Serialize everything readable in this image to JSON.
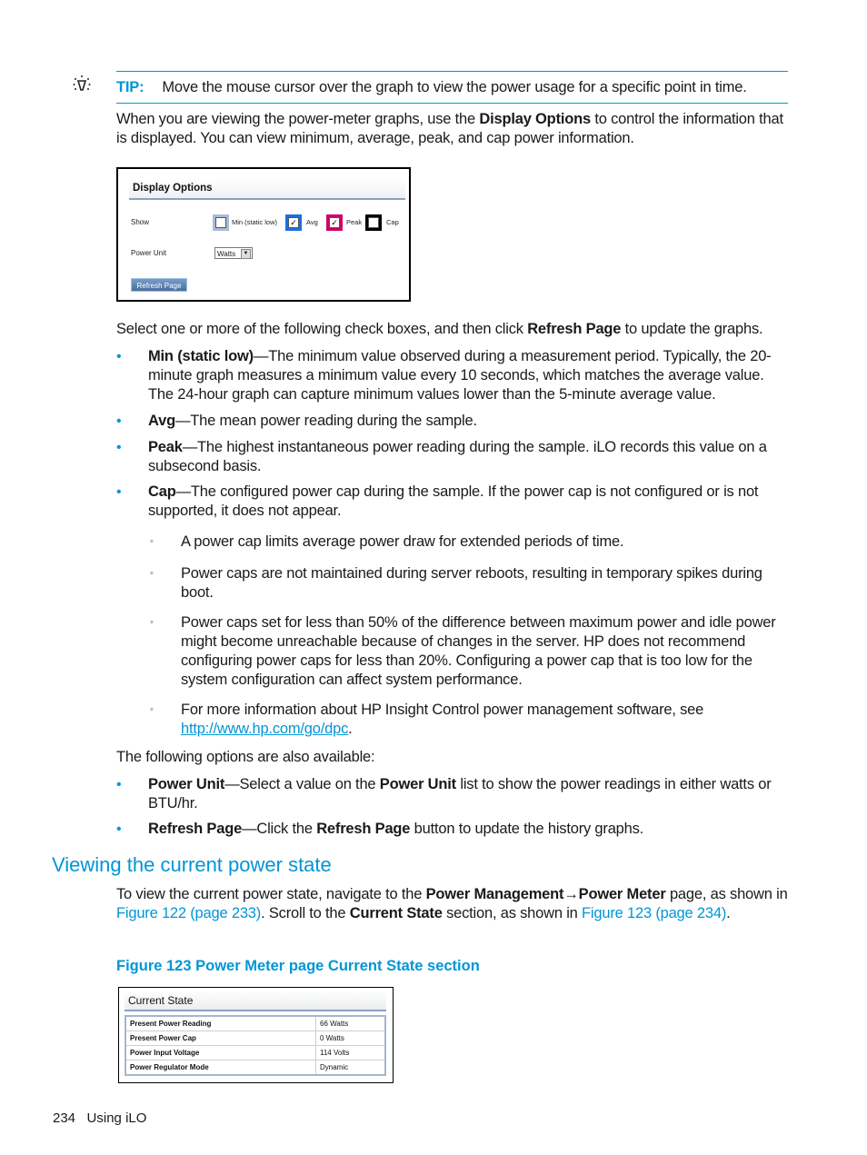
{
  "tip": {
    "icon": "lightbulb-icon",
    "label": "TIP:",
    "text": "Move the mouse cursor over the graph to view the power usage for a specific point in time."
  },
  "intro": {
    "p1_before": "When you are viewing the power-meter graphs, use the ",
    "p1_bold": "Display Options",
    "p1_after": " to control the information that is displayed. You can view minimum, average, peak, and cap power information."
  },
  "display_options": {
    "title": "Display Options",
    "show_label": "Show",
    "checkboxes": [
      {
        "label": "Min (static low)",
        "checked": false,
        "color": "#a9bcd6"
      },
      {
        "label": "Avg",
        "checked": true,
        "color": "#1a6fe0"
      },
      {
        "label": "Peak",
        "checked": true,
        "color": "#cc0066"
      },
      {
        "label": "Cap",
        "checked": false,
        "color": "#000000"
      }
    ],
    "checked_glyph": "✓",
    "power_unit_label": "Power Unit",
    "power_unit_value": "Watts",
    "dropdown_arrow": "▼",
    "refresh_button": "Refresh Page"
  },
  "select_para": {
    "before": "Select one or more of the following check boxes, and then click ",
    "bold": "Refresh Page",
    "after": " to update the graphs."
  },
  "bullets": [
    {
      "term": "Min (static low)",
      "text": "—The minimum value observed during a measurement period. Typically, the 20-minute graph measures a minimum value every 10 seconds, which matches the average value. The 24-hour graph can capture minimum values lower than the 5-minute average value."
    },
    {
      "term": "Avg",
      "text": "—The mean power reading during the sample."
    },
    {
      "term": "Peak",
      "text": "—The highest instantaneous power reading during the sample. iLO records this value on a subsecond basis."
    },
    {
      "term": "Cap",
      "text": "—The configured power cap during the sample. If the power cap is not configured or is not supported, it does not appear."
    }
  ],
  "bullet_glyph": "•",
  "sub_bullet_glyph": "◦",
  "sub_bullets": [
    {
      "text": "A power cap limits average power draw for extended periods of time."
    },
    {
      "text": "Power caps are not maintained during server reboots, resulting in temporary spikes during boot."
    },
    {
      "text": "Power caps set for less than 50% of the difference between maximum power and idle power might become unreachable because of changes in the server. HP does not recommend configuring power caps for less than 20%. Configuring a power cap that is too low for the system configuration can affect system performance."
    },
    {
      "text": "For more information about HP Insight Control power management software, see ",
      "link": "http://www.hp.com/go/dpc",
      "after": "."
    }
  ],
  "options_para": "The following options are also available:",
  "options_bullets": [
    {
      "term": "Power Unit",
      "text1": "—Select a value on the ",
      "bold2": "Power Unit",
      "text2": " list to show the power readings in either watts or BTU/hr."
    },
    {
      "term": "Refresh Page",
      "text1": "—Click the ",
      "bold2": "Refresh Page",
      "text2": " button to update the history graphs."
    }
  ],
  "section": {
    "heading": "Viewing the current power state",
    "p_before": "To view the current power state, navigate to the ",
    "p_bold1": "Power Management",
    "p_arrow": "→",
    "p_bold2": "Power Meter",
    "p_mid1": " page, as shown in ",
    "p_xref1": "Figure 122 (page 233)",
    "p_mid2": ". Scroll to the ",
    "p_bold3": "Current State",
    "p_mid3": " section, as shown in ",
    "p_xref2": "Figure 123 (page 234)",
    "p_end": "."
  },
  "figure_caption": "Figure 123 Power Meter page Current State section",
  "current_state": {
    "title": "Current State",
    "rows": [
      {
        "key": "Present Power Reading",
        "value": "66 Watts"
      },
      {
        "key": "Present Power Cap",
        "value": "0 Watts"
      },
      {
        "key": "Power Input Voltage",
        "value": "114 Volts"
      },
      {
        "key": "Power Regulator Mode",
        "value": "Dynamic"
      }
    ]
  },
  "footer": {
    "page_number": "234",
    "section": "Using iLO"
  }
}
